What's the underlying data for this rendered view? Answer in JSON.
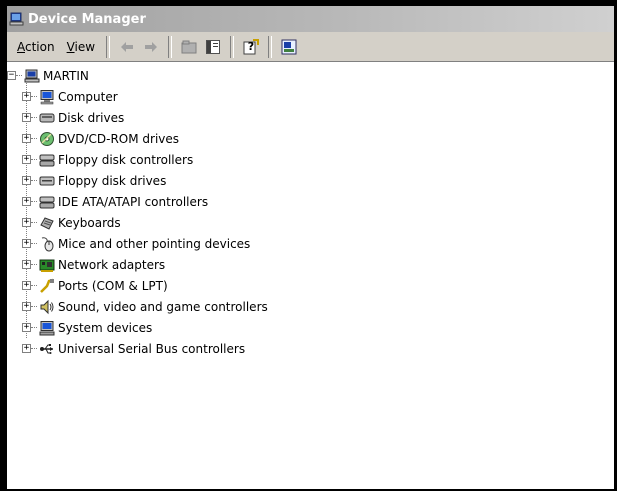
{
  "window": {
    "title": "Device Manager"
  },
  "menu": {
    "action": {
      "accel": "A",
      "rest": "ction"
    },
    "view": {
      "accel": "V",
      "rest": "iew"
    }
  },
  "toolbar": {
    "buttons": [
      {
        "name": "back-button",
        "icon": "arrow-left-icon"
      },
      {
        "name": "forward-button",
        "icon": "arrow-right-icon"
      },
      {
        "name": "up-one-level-button",
        "icon": "folder-up-icon"
      },
      {
        "name": "show-hide-tree-button",
        "icon": "console-tree-icon"
      },
      {
        "name": "help-button",
        "icon": "help-icon"
      },
      {
        "name": "properties-button",
        "icon": "properties-icon"
      }
    ]
  },
  "tree": {
    "root": {
      "label": "MARTIN",
      "expander": "−",
      "icon": "computer-icon"
    },
    "children": [
      {
        "label": "Computer",
        "icon": "computer-icon"
      },
      {
        "label": "Disk drives",
        "icon": "disk-drive-icon"
      },
      {
        "label": "DVD/CD-ROM drives",
        "icon": "cdrom-icon"
      },
      {
        "label": "Floppy disk controllers",
        "icon": "controller-icon"
      },
      {
        "label": "Floppy disk drives",
        "icon": "floppy-drive-icon"
      },
      {
        "label": "IDE ATA/ATAPI controllers",
        "icon": "ide-controller-icon"
      },
      {
        "label": "Keyboards",
        "icon": "keyboard-icon"
      },
      {
        "label": "Mice and other pointing devices",
        "icon": "mouse-icon"
      },
      {
        "label": "Network adapters",
        "icon": "network-adapter-icon"
      },
      {
        "label": "Ports (COM & LPT)",
        "icon": "port-icon"
      },
      {
        "label": "Sound, video and game controllers",
        "icon": "speaker-icon"
      },
      {
        "label": "System devices",
        "icon": "system-device-icon"
      },
      {
        "label": "Universal Serial Bus controllers",
        "icon": "usb-icon"
      }
    ],
    "child_expander": "+"
  },
  "colors": {
    "title_bar": "#a0a0a0",
    "toolbar_bg": "#d4d0c8"
  }
}
